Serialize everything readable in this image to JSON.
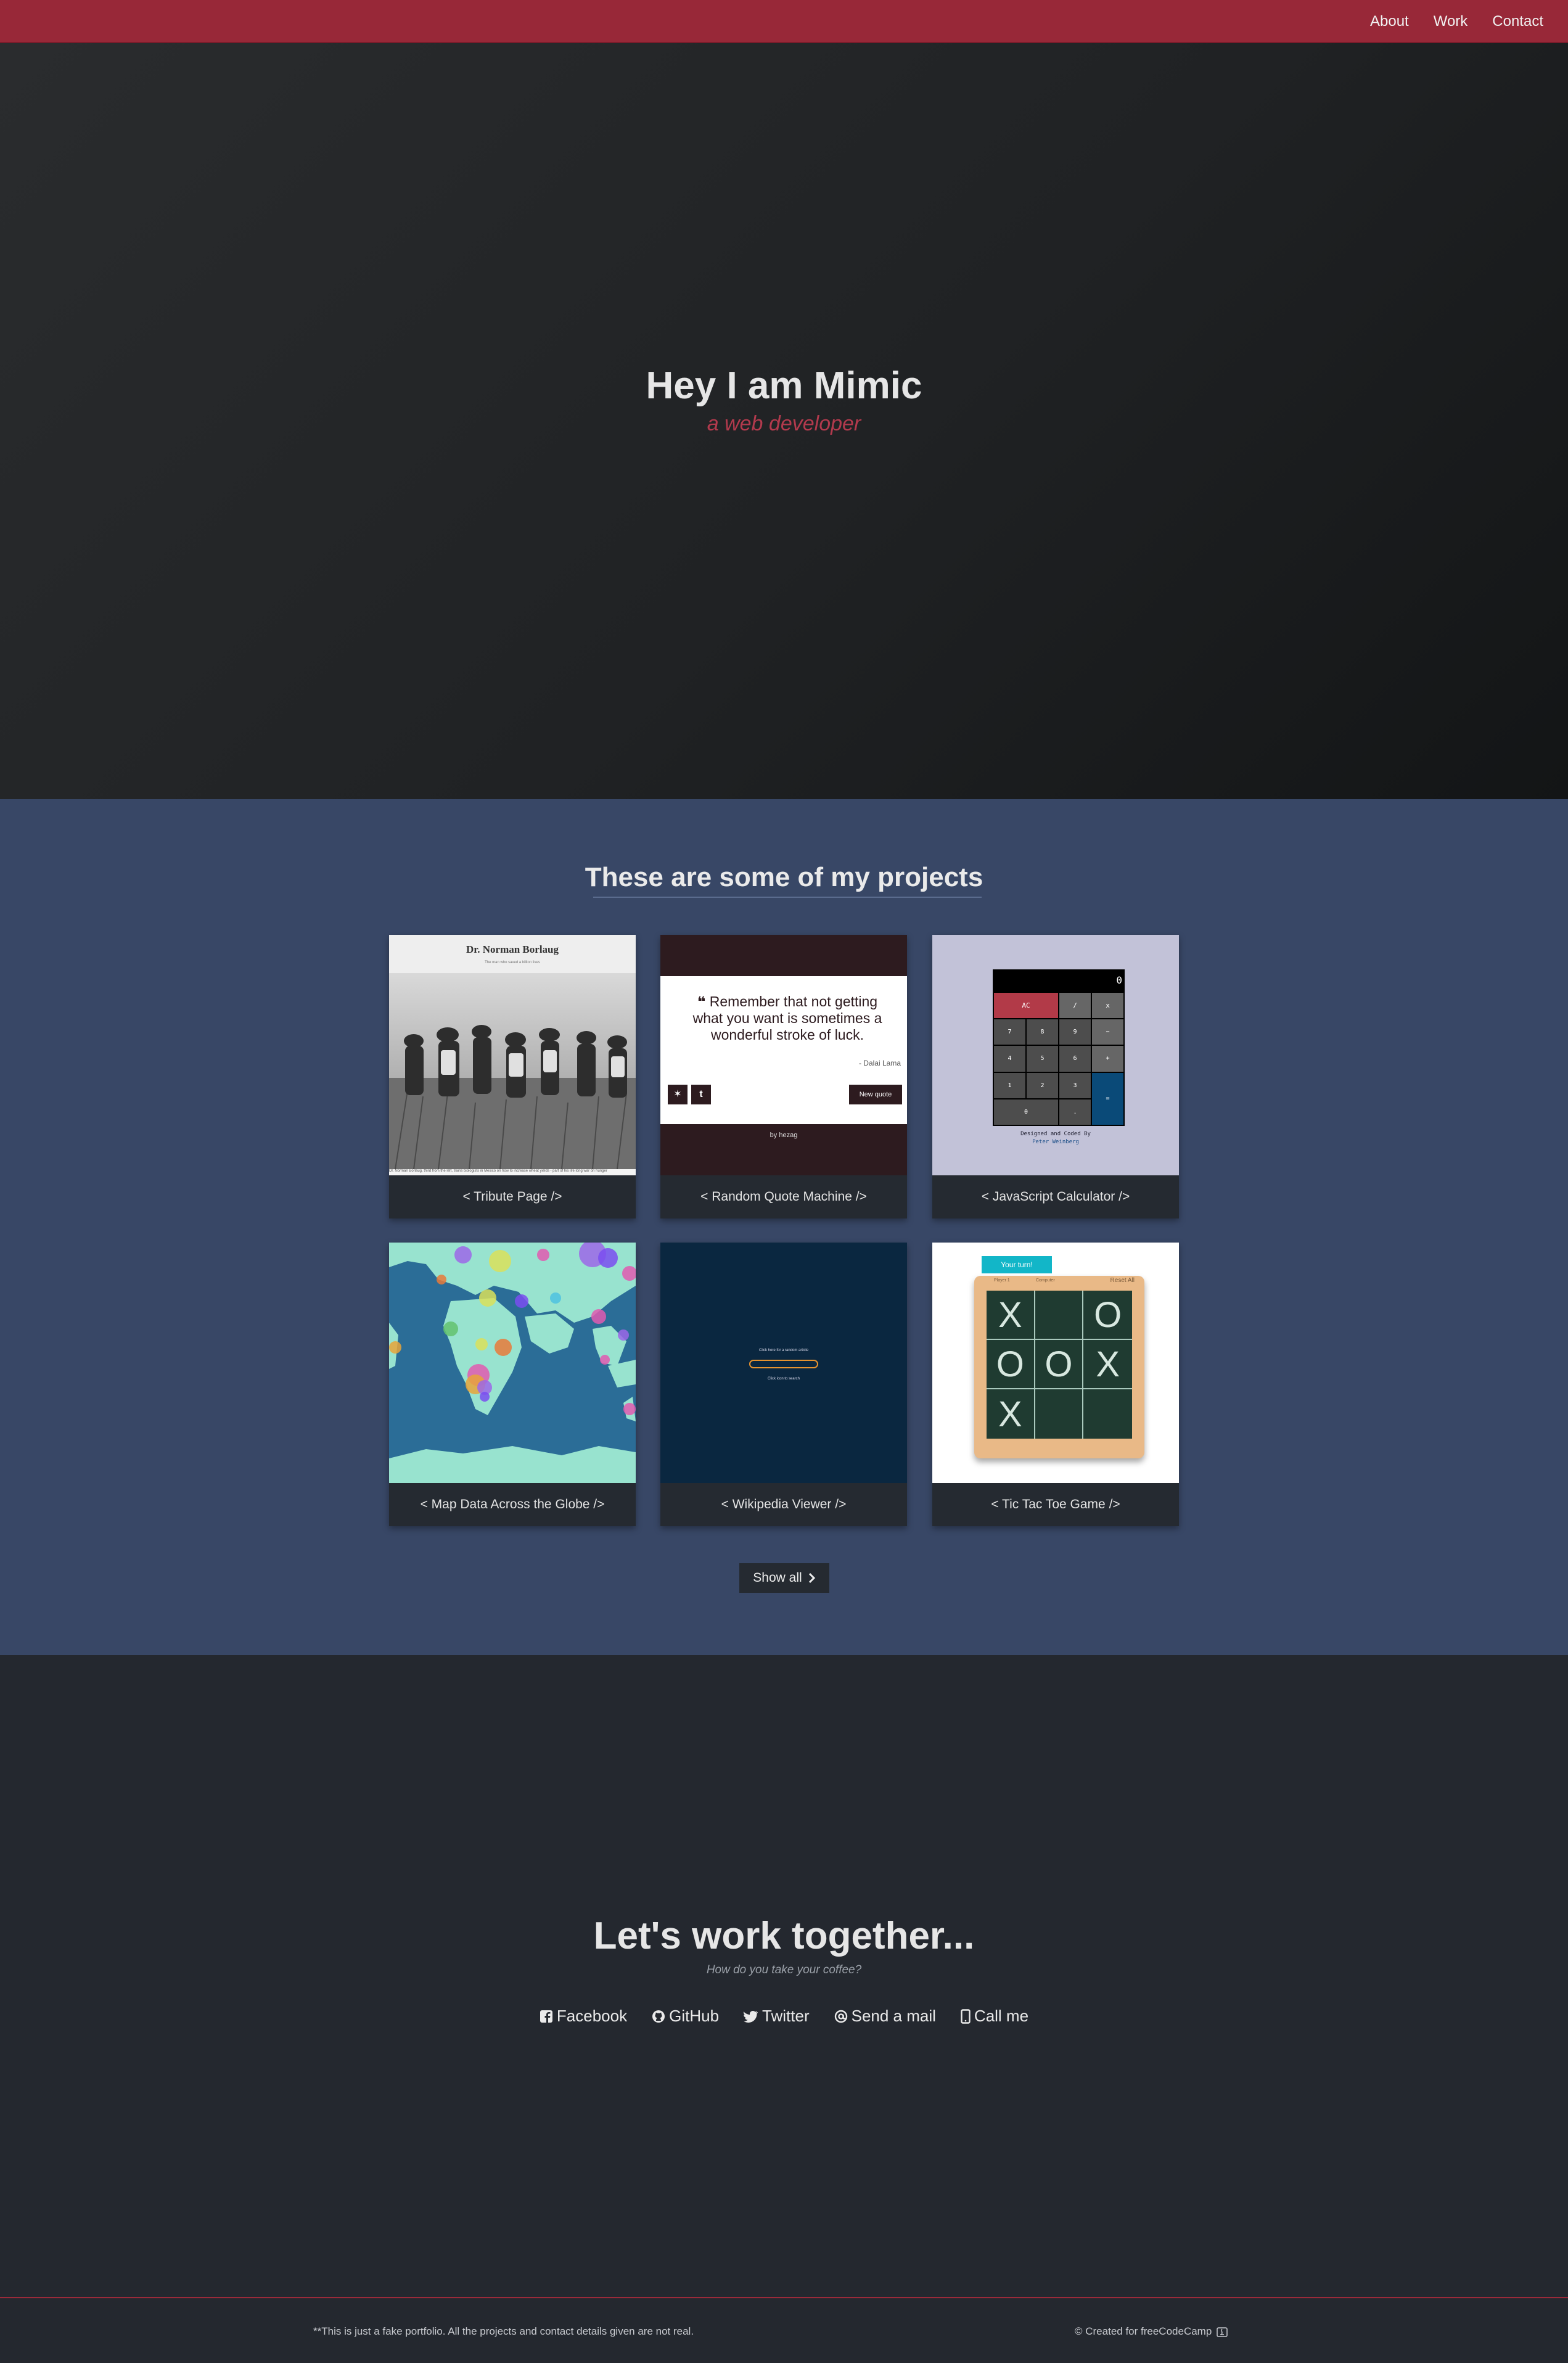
{
  "nav": {
    "items": [
      "About",
      "Work",
      "Contact"
    ]
  },
  "hero": {
    "title": "Hey I am Mimic",
    "subtitle": "a web developer"
  },
  "projects": {
    "title": "These are some of my projects",
    "cards": [
      {
        "caption": "< Tribute Page />"
      },
      {
        "caption": "< Random Quote Machine />"
      },
      {
        "caption": "< JavaScript Calculator />"
      },
      {
        "caption": "< Map Data Across the Globe />"
      },
      {
        "caption": "< Wikipedia Viewer />"
      },
      {
        "caption": "< Tic Tac Toe Game />"
      }
    ],
    "show_all": "Show all"
  },
  "tribute": {
    "title": "Dr. Norman Borlaug",
    "subtitle": "The man who saved a billion lives",
    "footnote": "Dr. Norman Borlaug, third from the left, trains biologists in Mexico on how to increase wheat yields - part of his life long war on hunger"
  },
  "quote": {
    "text": "Remember that not getting what you want is sometimes a wonderful stroke of luck.",
    "author": "- Dalai Lama",
    "button": "New quote",
    "by": "by hezag"
  },
  "calculator": {
    "display": "0",
    "keys": [
      "AC",
      "/",
      "x",
      "7",
      "8",
      "9",
      "−",
      "4",
      "5",
      "6",
      "+",
      "1",
      "2",
      "3",
      "=",
      "0",
      "."
    ],
    "credit_1": "Designed and Coded By",
    "credit_2": "Peter Weinberg"
  },
  "wiki": {
    "line1": "Click here for a random article",
    "line2": "Click icon to search"
  },
  "tictactoe": {
    "turn": "Your turn!",
    "tab1": "Player 1",
    "tab2": "Computer",
    "reset": "Reset All",
    "board": [
      "X",
      "",
      "O",
      "O",
      "O",
      "X",
      "X",
      "",
      ""
    ]
  },
  "contact": {
    "title": "Let's work together...",
    "tagline": "How do you take your coffee?",
    "links": [
      "Facebook",
      "GitHub",
      "Twitter",
      "Send a mail",
      "Call me"
    ]
  },
  "footer": {
    "disclaimer": "**This is just a fake portfolio. All the projects and contact details given are not real.",
    "credit": "© Created for freeCodeCamp"
  }
}
